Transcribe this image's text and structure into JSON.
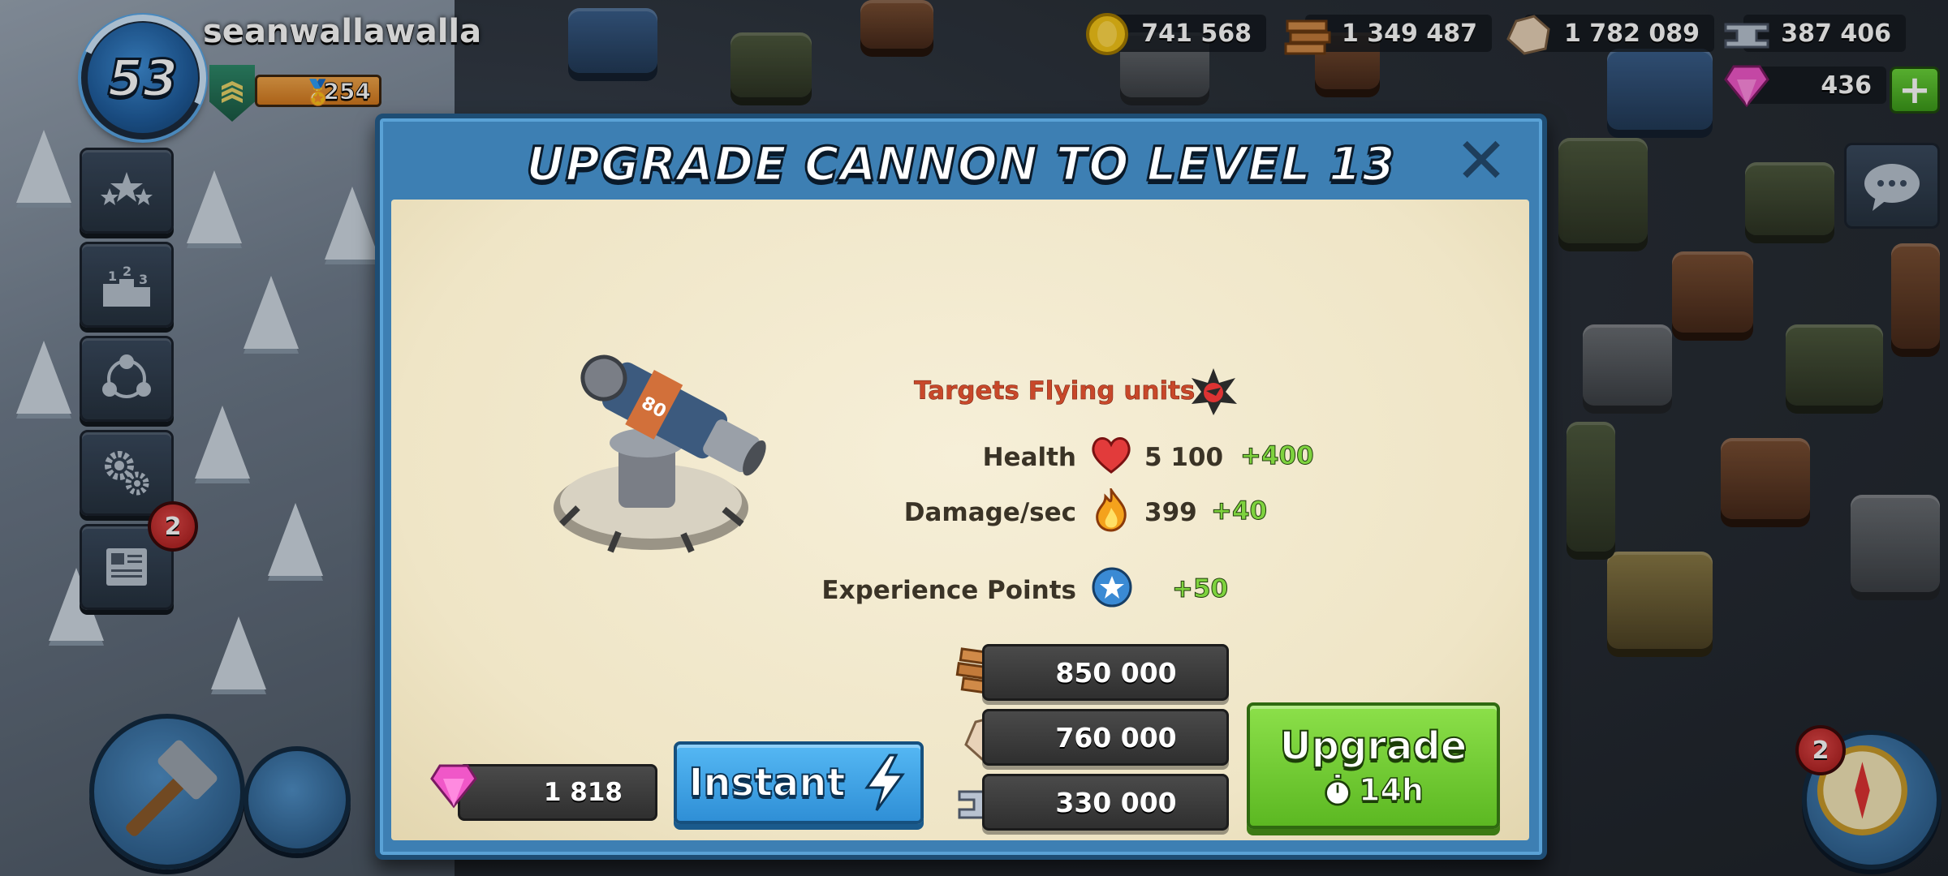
{
  "player": {
    "level": "53",
    "username": "seanwallawalla",
    "victory_points": "254"
  },
  "resources": {
    "gold": "741 568",
    "wood": "1 349 487",
    "stone": "1 782 089",
    "iron": "387 406",
    "diamonds": "436",
    "add_diamonds_label": "+"
  },
  "side_menu": {
    "news_badge": "2",
    "map_badge": "2"
  },
  "modal": {
    "title": "Upgrade Cannon to Level 13",
    "close_label": "✕",
    "building_plate": "80",
    "targets_text": "Targets Flying units",
    "stats": [
      {
        "label": "Health",
        "value": "5 100",
        "bonus": "+400",
        "icon": "heart-icon"
      },
      {
        "label": "Damage/sec",
        "value": "399",
        "bonus": "+40",
        "icon": "fire-icon"
      },
      {
        "label": "Experience Points",
        "value": "",
        "bonus": "+50",
        "icon": "star-icon"
      }
    ],
    "costs": {
      "wood": "850 000",
      "stone": "760 000",
      "iron": "330 000"
    },
    "instant": {
      "diamond_cost": "1 818",
      "label": "Instant"
    },
    "upgrade": {
      "label": "Upgrade",
      "time": "14h"
    }
  },
  "colors": {
    "modal_frame": "#3d7fb3",
    "paper": "#efe5c6",
    "targets_red": "#c8482a",
    "bonus_green": "#7ed23e",
    "instant_blue": "#2f8fd6",
    "upgrade_green": "#5cb822"
  }
}
